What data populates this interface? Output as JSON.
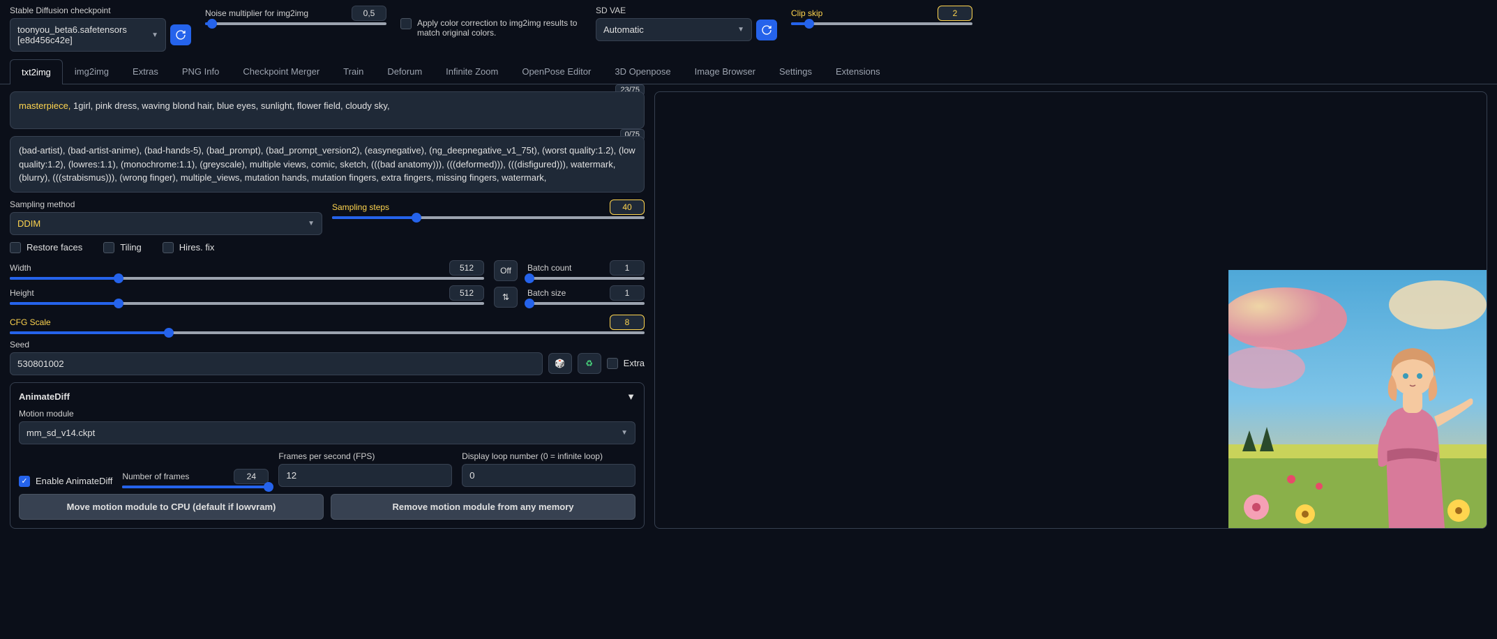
{
  "top": {
    "checkpoint_label": "Stable Diffusion checkpoint",
    "checkpoint_value": "toonyou_beta6.safetensors [e8d456c42e]",
    "noise_label": "Noise multiplier for img2img",
    "noise_value": "0,5",
    "color_label": "Apply color correction to img2img results to match original colors.",
    "vae_label": "SD VAE",
    "vae_value": "Automatic",
    "clip_label": "Clip skip",
    "clip_value": "2"
  },
  "tabs": [
    "txt2img",
    "img2img",
    "Extras",
    "PNG Info",
    "Checkpoint Merger",
    "Train",
    "Deforum",
    "Infinite Zoom",
    "OpenPose Editor",
    "3D Openpose",
    "Image Browser",
    "Settings",
    "Extensions"
  ],
  "prompt": {
    "first": "masterpiece,",
    "rest": " 1girl, pink dress, waving blond hair, blue eyes, sunlight, flower field, cloudy sky,",
    "tokens": "23/75"
  },
  "neg_prompt": {
    "text": "(bad-artist), (bad-artist-anime), (bad-hands-5), (bad_prompt), (bad_prompt_version2), (easynegative), (ng_deepnegative_v1_75t), (worst quality:1.2), (low quality:1.2), (lowres:1.1), (monochrome:1.1), (greyscale), multiple views, comic, sketch, (((bad anatomy))), (((deformed))), (((disfigured))), watermark,(blurry), (((strabismus))), (wrong finger), multiple_views, mutation hands, mutation fingers, extra fingers, missing fingers, watermark,",
    "tokens": "0/75"
  },
  "sampling": {
    "method_label": "Sampling method",
    "method_value": "DDIM",
    "steps_label": "Sampling steps",
    "steps_value": "40"
  },
  "checks": {
    "restore": "Restore faces",
    "tiling": "Tiling",
    "hires": "Hires. fix"
  },
  "dims": {
    "width_label": "Width",
    "width_value": "512",
    "height_label": "Height",
    "height_value": "512",
    "off": "Off",
    "swap": "⇅",
    "batch_count_label": "Batch count",
    "batch_count": "1",
    "batch_size_label": "Batch size",
    "batch_size": "1"
  },
  "cfg": {
    "label": "CFG Scale",
    "value": "8"
  },
  "seed": {
    "label": "Seed",
    "value": "530801002",
    "dice": "🎲",
    "recycle": "♻",
    "extra": "Extra"
  },
  "ad": {
    "title": "AnimateDiff",
    "module_label": "Motion module",
    "module_value": "mm_sd_v14.ckpt",
    "enable": "Enable AnimateDiff",
    "frames_label": "Number of frames",
    "frames_value": "24",
    "fps_label": "Frames per second (FPS)",
    "fps_value": "12",
    "loop_label": "Display loop number (0 = infinite loop)",
    "loop_value": "0",
    "btn_cpu": "Move motion module to CPU (default if lowvram)",
    "btn_remove": "Remove motion module from any memory"
  }
}
